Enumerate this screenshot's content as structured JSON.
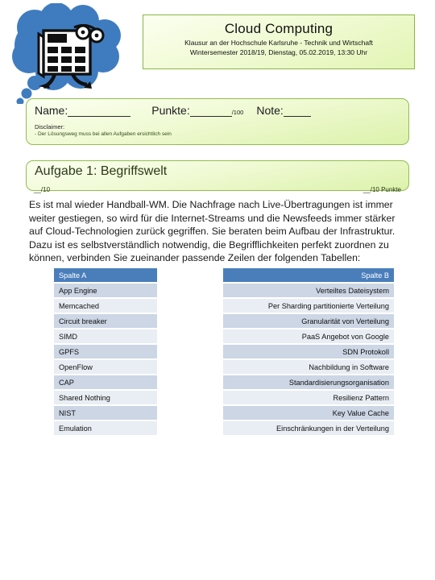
{
  "icon": {
    "bubble": "thought-bubble-icon",
    "inner": "calendar-character-icon"
  },
  "header": {
    "title": "Cloud Computing",
    "subtitle_line1": "Klausur an der Hochschule Karlsruhe - Technik und Wirtschaft",
    "subtitle_line2": "Wintersemester 2018/19, Dienstag, 05.02.2019, 13:30 Uhr",
    "accent_color": "#8db544",
    "fill_color": "#e2f5b4"
  },
  "name_panel": {
    "name_label": "Name:",
    "punkte_label": "Punkte:",
    "punkte_total": "/100",
    "note_label": "Note:",
    "disclaimer_label": "Disclaimer:",
    "disclaimer_text": "- Der Lösungsweg muss bei allen Aufgaben ersichtlich sein"
  },
  "task": {
    "title": "Aufgabe 1: Begriffswelt",
    "points_left": "__/10",
    "points_right": "__/10 Punkte",
    "body": "Es ist mal wieder Handball-WM. Die Nachfrage nach Live-Übertragungen ist immer weiter gestiegen, so wird für die Internet-Streams und die Newsfeeds immer stärker auf Cloud-Technologien zurück gegriffen. Sie beraten beim Aufbau der Infrastruktur. Dazu ist es selbstverständlich notwendig, die Begrifflichkeiten perfekt zuordnen zu können, verbinden Sie zueinander passende Zeilen der folgenden Tabellen:"
  },
  "tables": {
    "header_color": "#4a7ebb",
    "row_dark_color": "#ccd6e5",
    "row_light_color": "#e9eef4",
    "column_a": {
      "header": "Spalte A",
      "rows": [
        "App Engine",
        "Memcached",
        "Circuit breaker",
        "SIMD",
        "GPFS",
        "OpenFlow",
        "CAP",
        "Shared Nothing",
        "NIST",
        "Emulation"
      ]
    },
    "column_b": {
      "header": "Spalte B",
      "rows": [
        "Verteiltes Dateisystem",
        "Per Sharding partitionierte Verteilung",
        "Granularität von Verteilung",
        "PaaS Angebot von Google",
        "SDN Protokoll",
        "Nachbildung in Software",
        "Standardisierungsorganisation",
        "Resilienz Pattern",
        "Key Value Cache",
        "Einschränkungen in der Verteilung"
      ]
    }
  }
}
